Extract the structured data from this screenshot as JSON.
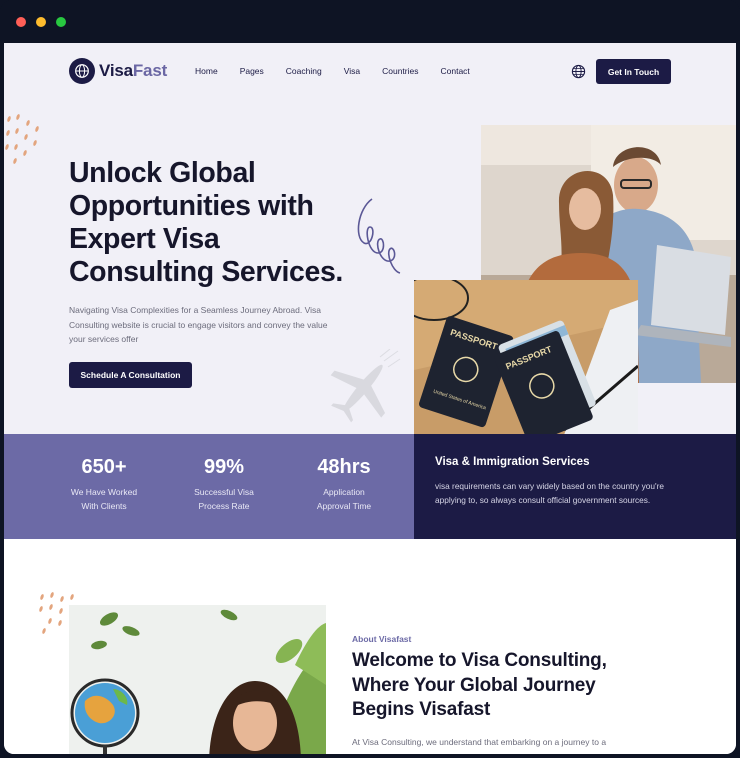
{
  "window": {
    "dot_colors": [
      "#ff5f57",
      "#febc2e",
      "#28c840"
    ]
  },
  "header": {
    "logo_part1": "Visa",
    "logo_part2": "Fast",
    "nav": [
      "Home",
      "Pages",
      "Coaching",
      "Visa",
      "Countries",
      "Contact"
    ],
    "cta_label": "Get In Touch",
    "globe_icon": "globe-icon"
  },
  "hero": {
    "title": "Unlock Global Opportunities with Expert Visa Consulting Services.",
    "description": "Navigating Visa Complexities for a Seamless Journey Abroad. Visa Consulting website is crucial to engage visitors and convey the value your services offer",
    "cta_label": "Schedule A Consultation",
    "passport_label": "PASSPORT",
    "passport_country": "United States of America"
  },
  "stats": [
    {
      "number": "650+",
      "label_line1": "We Have Worked",
      "label_line2": "With Clients"
    },
    {
      "number": "99%",
      "label_line1": "Successful Visa",
      "label_line2": "Process Rate"
    },
    {
      "number": "48hrs",
      "label_line1": "Application",
      "label_line2": "Approval Time"
    }
  ],
  "services": {
    "title": "Visa & Immigration Services",
    "description": "visa requirements can vary widely based on the country you're applying to, so always consult official government sources."
  },
  "about": {
    "eyebrow": "About Visafast",
    "title": "Welcome to Visa Consulting, Where Your Global Journey Begins Visafast",
    "description": "At Visa Consulting, we understand that embarking on a journey to a"
  },
  "colors": {
    "brand_dark": "#1c1b45",
    "brand_purple": "#6c6aa6",
    "hero_bg": "#f1f0f7"
  }
}
